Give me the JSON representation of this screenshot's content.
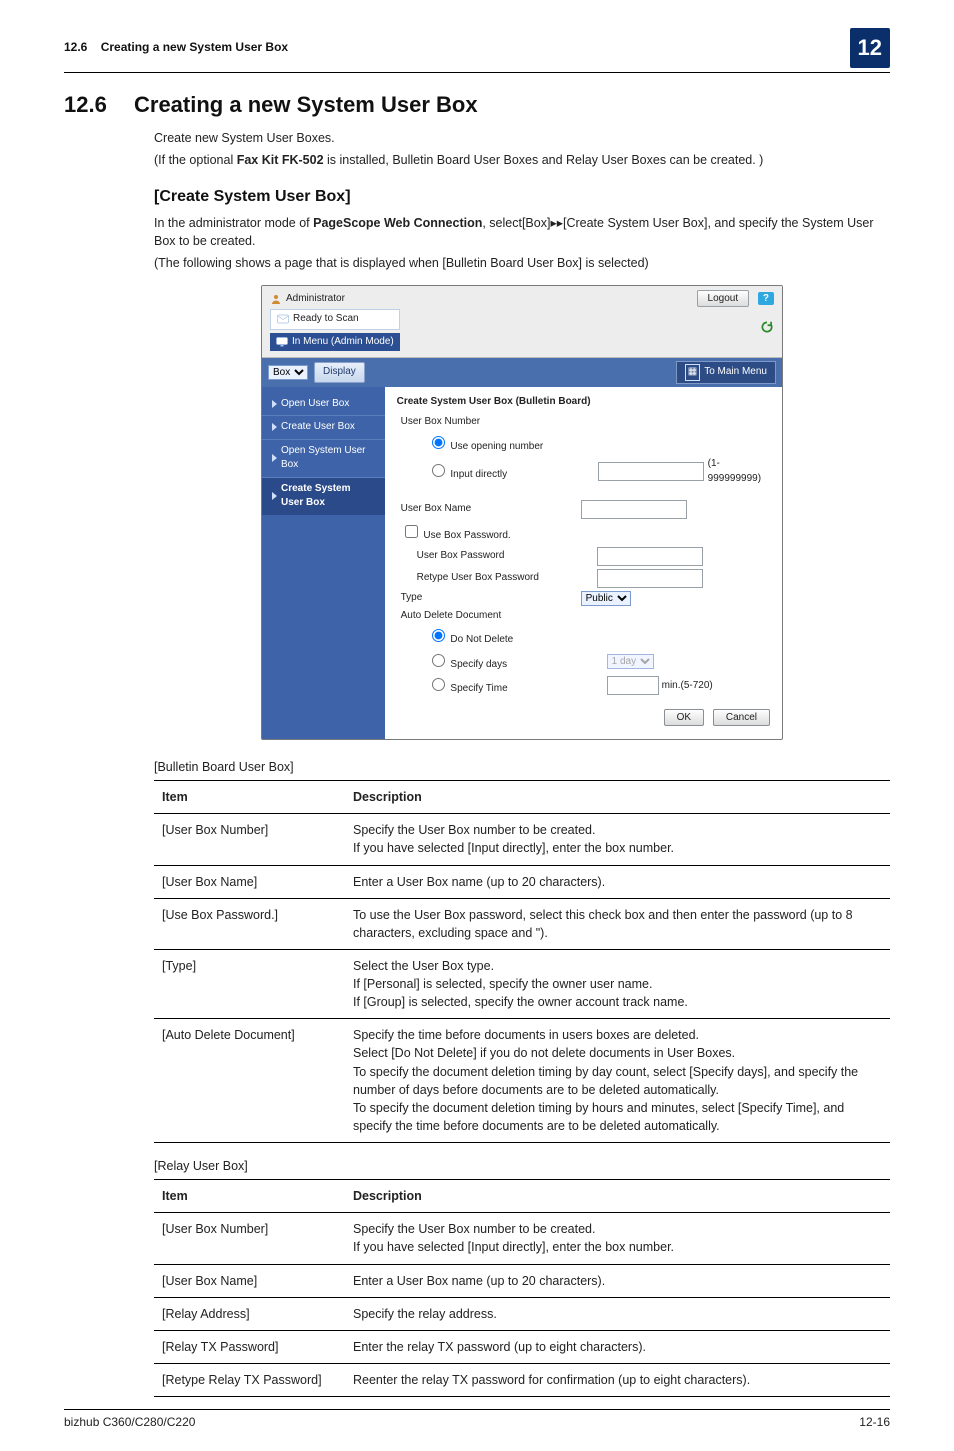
{
  "running_head": {
    "section": "12.6",
    "title": "Creating a new System User Box",
    "chapter": "12"
  },
  "heading": {
    "number": "12.6",
    "title": "Creating a new System User Box"
  },
  "intro": {
    "line1": "Create new System User Boxes.",
    "line2_pre": "(If the optional ",
    "line2_bold": "Fax Kit FK-502",
    "line2_post": " is installed, Bulletin Board User Boxes and Relay User Boxes can be created. )"
  },
  "subheading": "[Create System User Box]",
  "para1": {
    "pre": "In the administrator mode of ",
    "bold": "PageScope Web Connection",
    "post": ", select[Box]▸▸[Create System User Box], and specify the System User Box to be created."
  },
  "para2": "(The following shows a page that is displayed when [Bulletin Board User Box] is selected)",
  "screenshot": {
    "administrator": "Administrator",
    "ready": "Ready to Scan",
    "inmenu": "In Menu (Admin Mode)",
    "logout": "Logout",
    "help": "?",
    "select_value": "Box",
    "display": "Display",
    "to_main": "To Main Menu",
    "sidebar": [
      {
        "label": "Open User Box"
      },
      {
        "label": "Create User Box"
      },
      {
        "label": "Open System User Box"
      },
      {
        "label": "Create System User Box",
        "active": true
      }
    ],
    "form": {
      "title": "Create System User Box (Bulletin Board)",
      "user_box_number": "User Box Number",
      "use_opening": "Use opening number",
      "input_directly": "Input directly",
      "range": "(1-999999999)",
      "user_box_name": "User Box Name",
      "use_box_pwd": "Use Box Password.",
      "user_box_pwd": "User Box Password",
      "retype_pwd": "Retype User Box Password",
      "type": "Type",
      "type_value": "Public",
      "auto_delete": "Auto Delete Document",
      "do_not_delete": "Do Not Delete",
      "specify_days": "Specify days",
      "days_value": "1 day",
      "specify_time": "Specify Time",
      "time_suffix": "min.(5-720)",
      "ok": "OK",
      "cancel": "Cancel"
    }
  },
  "table1_caption": "[Bulletin Board User Box]",
  "table_headers": {
    "item": "Item",
    "desc": "Description"
  },
  "table1": [
    {
      "item": "[User Box Number]",
      "desc": "Specify the User Box number to be created.\nIf you have selected [Input directly], enter the box number."
    },
    {
      "item": "[User Box Name]",
      "desc": "Enter a User Box name (up to 20 characters)."
    },
    {
      "item": "[Use Box Password.]",
      "desc": "To use the User Box password, select this check box and then enter the password (up to 8 characters, excluding space and \")."
    },
    {
      "item": "[Type]",
      "desc": "Select the User Box type.\nIf [Personal] is selected, specify the owner user name.\nIf [Group] is selected, specify the owner account track name."
    },
    {
      "item": "[Auto Delete Document]",
      "desc": "Specify the time before documents in users boxes are deleted.\nSelect [Do Not Delete] if you do not delete documents in User Boxes.\nTo specify the document deletion timing by day count, select [Specify days], and specify the number of days before documents are to be deleted automatically.\nTo specify the document deletion timing by hours and minutes, select [Specify Time], and specify the time before documents are to be deleted automatically."
    }
  ],
  "table2_caption": "[Relay User Box]",
  "table2": [
    {
      "item": "[User Box Number]",
      "desc": "Specify the User Box number to be created.\nIf you have selected [Input directly], enter the box number."
    },
    {
      "item": "[User Box Name]",
      "desc": "Enter a User Box name (up to 20 characters)."
    },
    {
      "item": "[Relay Address]",
      "desc": "Specify the relay address."
    },
    {
      "item": "[Relay TX Password]",
      "desc": "Enter the relay TX password (up to eight characters)."
    },
    {
      "item": "[Retype Relay TX Password]",
      "desc": "Reenter the relay TX password for confirmation (up to eight characters)."
    }
  ],
  "footer": {
    "left": "bizhub C360/C280/C220",
    "right": "12-16"
  }
}
